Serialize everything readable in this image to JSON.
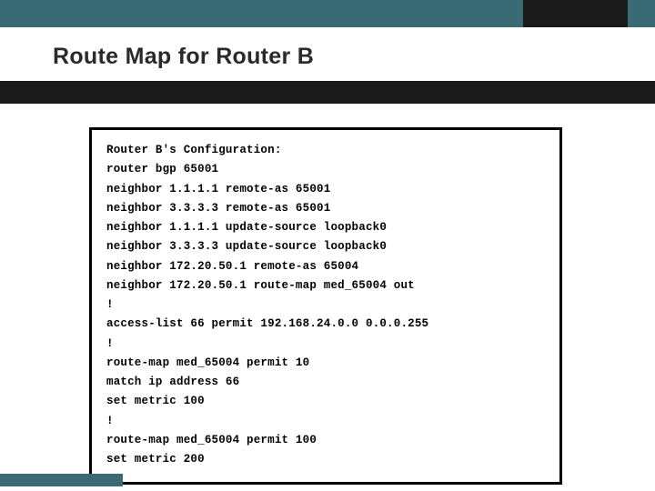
{
  "title": "Route Map for Router B",
  "config": {
    "header": "Router B's Configuration:",
    "lines": [
      "router bgp 65001",
      "neighbor 1.1.1.1 remote-as 65001",
      "neighbor 3.3.3.3 remote-as 65001",
      "neighbor 1.1.1.1 update-source loopback0",
      "neighbor 3.3.3.3 update-source loopback0",
      "neighbor 172.20.50.1 remote-as 65004",
      "neighbor 172.20.50.1 route-map med_65004 out",
      "!",
      "access-list 66 permit 192.168.24.0.0 0.0.0.255",
      "!",
      "route-map med_65004 permit 10",
      "match ip address 66",
      "set metric 100",
      "!",
      "route-map med_65004 permit 100",
      "set metric 200"
    ]
  }
}
